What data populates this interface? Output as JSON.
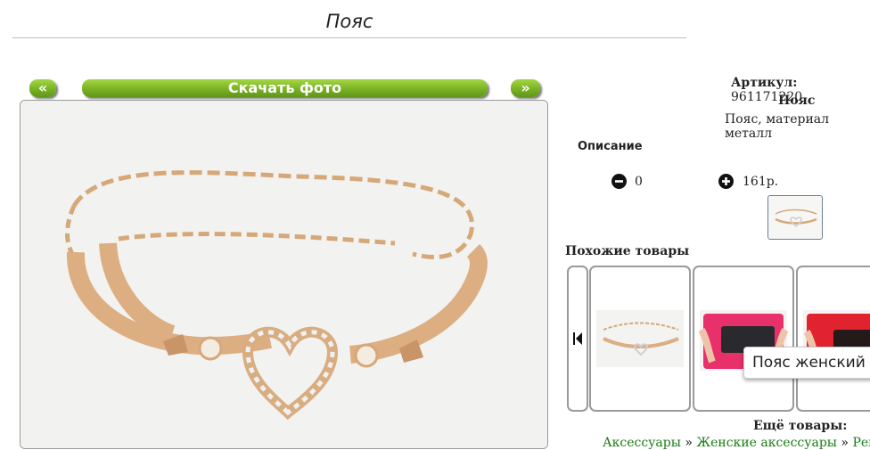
{
  "page": {
    "title": "Пояс"
  },
  "gallery": {
    "prev_label": "«",
    "next_label": "»",
    "download_label": "Скачать фото"
  },
  "product": {
    "article_label": "Артикул:",
    "article_value": "961171220",
    "name": "Пояс",
    "short_description": "Пояс, материал металл",
    "description_heading": "Описание",
    "quantity": "0",
    "price": "161р."
  },
  "similar": {
    "heading": "Похожие товары",
    "tooltip": "Пояс женский"
  },
  "more": {
    "heading": "Ещё товары:",
    "breadcrumb": [
      "Аксессуары",
      "Женские аксессуары",
      "Рем"
    ],
    "separator": "»"
  },
  "colors": {
    "accent_green": "#79b321",
    "link_green": "#1a7b12"
  }
}
